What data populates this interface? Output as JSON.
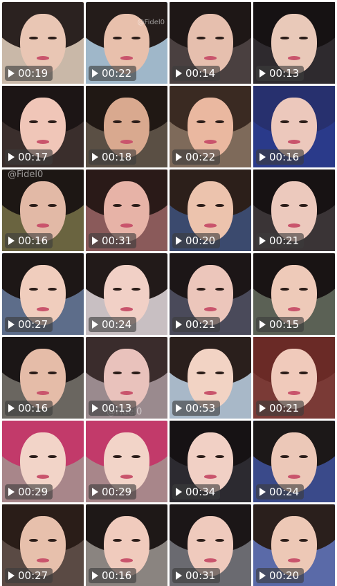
{
  "watermark_text": "@Fidel0",
  "videos": [
    {
      "duration": "00:19",
      "bg": "#c9b8a8",
      "hair": "#2b2220",
      "skin": "#e9c6b4"
    },
    {
      "duration": "00:22",
      "bg": "#9fb7c9",
      "hair": "#241c1a",
      "skin": "#e8c0ac",
      "watermark": true
    },
    {
      "duration": "00:14",
      "bg": "#4a4040",
      "hair": "#1e1716",
      "skin": "#e6bfae"
    },
    {
      "duration": "00:13",
      "bg": "#2e2a2e",
      "hair": "#161213",
      "skin": "#e9c9b9"
    },
    {
      "duration": "00:17",
      "bg": "#3a2e2c",
      "hair": "#1c1515",
      "skin": "#f0c6b8"
    },
    {
      "duration": "00:18",
      "bg": "#5a4f44",
      "hair": "#201814",
      "skin": "#d9a98f"
    },
    {
      "duration": "00:22",
      "bg": "#7e6a5a",
      "hair": "#3a2a22",
      "skin": "#eab8a0"
    },
    {
      "duration": "00:16",
      "bg": "#2a3a8a",
      "hair": "#27306e",
      "skin": "#ecc8bc"
    },
    {
      "duration": "00:16",
      "bg": "#6a6440",
      "hair": "#1d1714",
      "skin": "#e2b9a6",
      "watermark": true
    },
    {
      "duration": "00:31",
      "bg": "#8a5a5a",
      "hair": "#2a1a18",
      "skin": "#e7b3a7"
    },
    {
      "duration": "00:20",
      "bg": "#3b4a6e",
      "hair": "#2c1f1a",
      "skin": "#ecc3ad"
    },
    {
      "duration": "00:21",
      "bg": "#3a3436",
      "hair": "#171213",
      "skin": "#ecc9bd"
    },
    {
      "duration": "00:27",
      "bg": "#5d6d8a",
      "hair": "#1d1716",
      "skin": "#f0cdbd"
    },
    {
      "duration": "00:24",
      "bg": "#c8bfc2",
      "hair": "#221a19",
      "skin": "#f1d0c6"
    },
    {
      "duration": "00:21",
      "bg": "#4a4a5a",
      "hair": "#1c1617",
      "skin": "#ecc6bb"
    },
    {
      "duration": "00:15",
      "bg": "#5b6155",
      "hair": "#191414",
      "skin": "#eecab9"
    },
    {
      "duration": "00:16",
      "bg": "#6a6660",
      "hair": "#1b1616",
      "skin": "#e5bca8"
    },
    {
      "duration": "00:13",
      "bg": "#9a8a8e",
      "hair": "#3a2c2c",
      "skin": "#e9c2bc",
      "watermark": true
    },
    {
      "duration": "00:53",
      "bg": "#a8b8c8",
      "hair": "#2a1f1c",
      "skin": "#f2d3c4"
    },
    {
      "duration": "00:21",
      "bg": "#7a3a36",
      "hair": "#6a2a26",
      "skin": "#f0cabb"
    },
    {
      "duration": "00:29",
      "bg": "#a8868a",
      "hair": "#c23a6a",
      "skin": "#f2d4c8"
    },
    {
      "duration": "00:29",
      "bg": "#a8868a",
      "hair": "#c23a6a",
      "skin": "#f2d4c8"
    },
    {
      "duration": "00:34",
      "bg": "#2c2a30",
      "hair": "#161214",
      "skin": "#f1d0c5"
    },
    {
      "duration": "00:24",
      "bg": "#3a4a8a",
      "hair": "#1c1818",
      "skin": "#ecc8b8"
    },
    {
      "duration": "00:27",
      "bg": "#5a4a44",
      "hair": "#2a1d18",
      "skin": "#e7c0ac"
    },
    {
      "duration": "00:16",
      "bg": "#8a8480",
      "hair": "#1e1817",
      "skin": "#f0cbbd"
    },
    {
      "duration": "00:31",
      "bg": "#6a6a70",
      "hair": "#1b1617",
      "skin": "#efcabd"
    },
    {
      "duration": "00:20",
      "bg": "#5a6aa8",
      "hair": "#2a1f1c",
      "skin": "#edc8b6"
    }
  ]
}
